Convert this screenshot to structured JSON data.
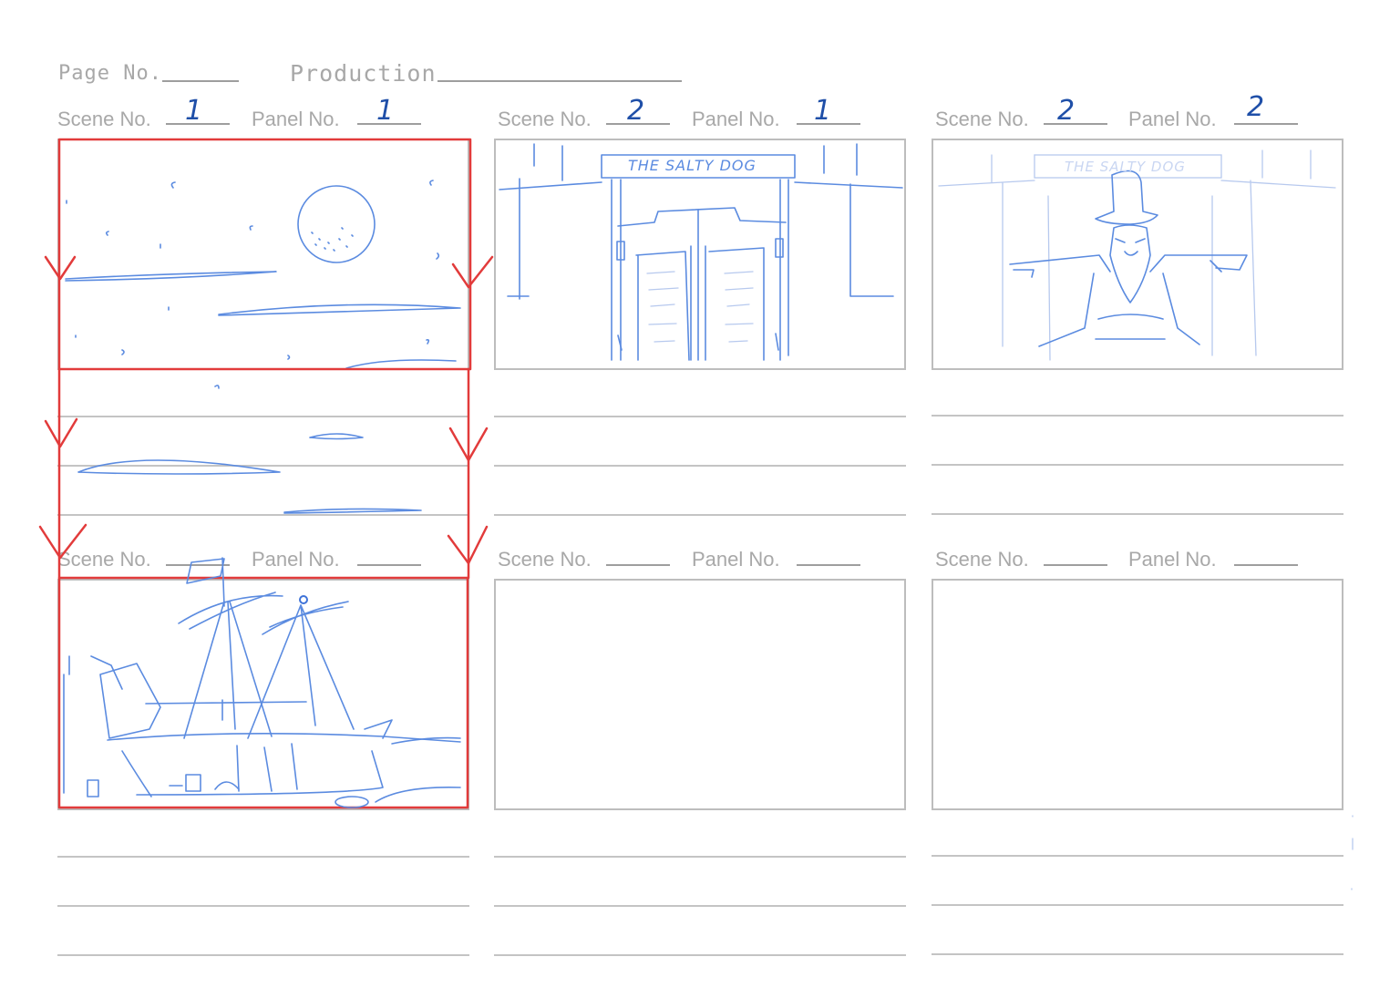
{
  "header": {
    "page_no_label": "Page No.",
    "page_no_value": "",
    "production_label": "Production",
    "production_value": ""
  },
  "labels": {
    "scene": "Scene No.",
    "panel": "Panel No."
  },
  "panels": [
    {
      "scene": "1",
      "panel": "1"
    },
    {
      "scene": "2",
      "panel": "1"
    },
    {
      "scene": "2",
      "panel": "2"
    },
    {
      "scene": "",
      "panel": ""
    },
    {
      "scene": "",
      "panel": ""
    },
    {
      "scene": "",
      "panel": ""
    }
  ],
  "sign_text": "THE SALTY DOG",
  "colors": {
    "sketch_blue": "#5b8be0",
    "pan_marker_red": "#e23b3b",
    "frame_gray": "#bdbdbd"
  }
}
